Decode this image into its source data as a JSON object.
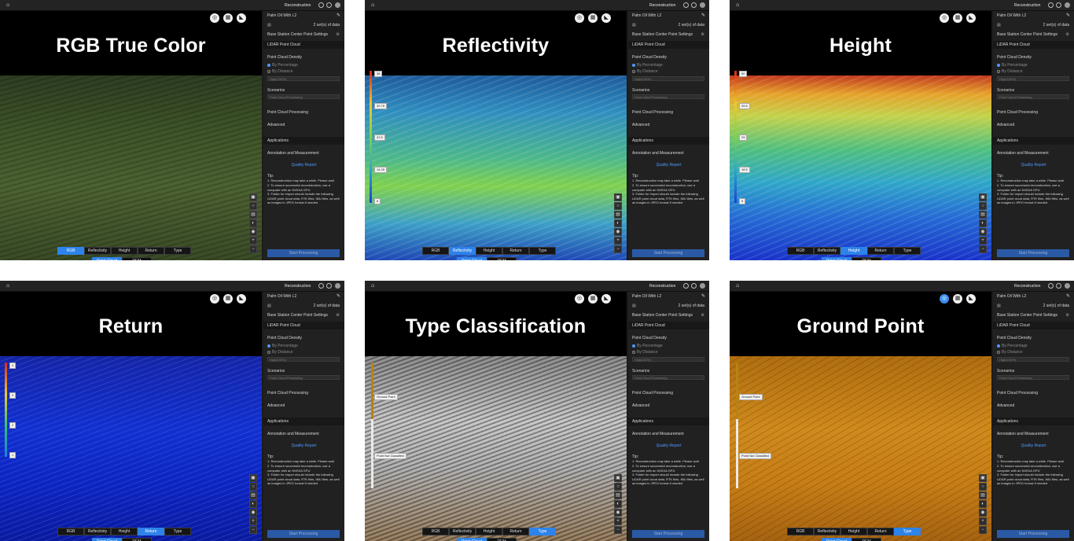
{
  "app": {
    "topbar_title": "Reconstruction",
    "project_name": "Palm Oil With L2",
    "data_sets": "2 set(s) of data",
    "base_station": "Base Station Center Point Settings",
    "lidar_section": "LiDAR Point Cloud",
    "density_label": "Point Cloud Density",
    "by_percentage": "By Percentage",
    "by_distance": "By Distance",
    "density_value": "High(100%)",
    "scenarios_label": "Scenarios",
    "scenario_value": "Point Cloud Processing",
    "pc_processing": "Point Cloud Processing",
    "advanced": "Advanced",
    "applications": "Applications",
    "annotation": "Annotation and Measurement",
    "quality_report": "Quality Report",
    "tip_title": "Tip:",
    "tip_1": "1. Reconstruction may take a while. Please wait",
    "tip_2": "2. To ensure successful reconstruction, use a computer with an NVIDIA GPU",
    "tip_3": "3. Folder for import should include the following LiDAR point cloud data, RTK files, IMU files, as well as images in JPEG format if needed",
    "start_button": "Start Processing",
    "mode_tabs": [
      "RGB",
      "Reflectivity",
      "Height",
      "Return",
      "Type"
    ],
    "view_tabs": [
      "Point Cloud",
      "DEM"
    ]
  },
  "panels": [
    {
      "title": "RGB True Color",
      "active_mode": 0,
      "style": "rgb",
      "legend": []
    },
    {
      "title": "Reflectivity",
      "active_mode": 1,
      "style": "refl",
      "legend": [
        "36",
        "30.75",
        "22.5",
        "14.25",
        "6"
      ]
    },
    {
      "title": "Height",
      "active_mode": 2,
      "style": "height",
      "legend": [
        "50",
        "39.5",
        "29",
        "18.5",
        "8"
      ]
    },
    {
      "title": "Return",
      "active_mode": 3,
      "style": "ret",
      "legend": [
        "4",
        "3",
        "2",
        "1"
      ]
    },
    {
      "title": "Type Classification",
      "active_mode": 4,
      "style": "typec",
      "legend": [
        "Ground Point",
        "Point Not Classified"
      ]
    },
    {
      "title": "Ground Point",
      "active_mode": 4,
      "style": "ground",
      "legend": [
        "Ground Point",
        "Point Not Classified"
      ]
    }
  ],
  "colors": {
    "accent": "#2d83ea",
    "sidebar_bg": "#212121",
    "link": "#4d9bff"
  },
  "icons": [
    "home-icon",
    "settings-icon",
    "help-icon",
    "avatar-icon",
    "edit-icon",
    "folder-icon",
    "gear-icon",
    "view-icon",
    "layer-icon",
    "measure-icon",
    "zoom-in-icon",
    "zoom-out-icon"
  ]
}
